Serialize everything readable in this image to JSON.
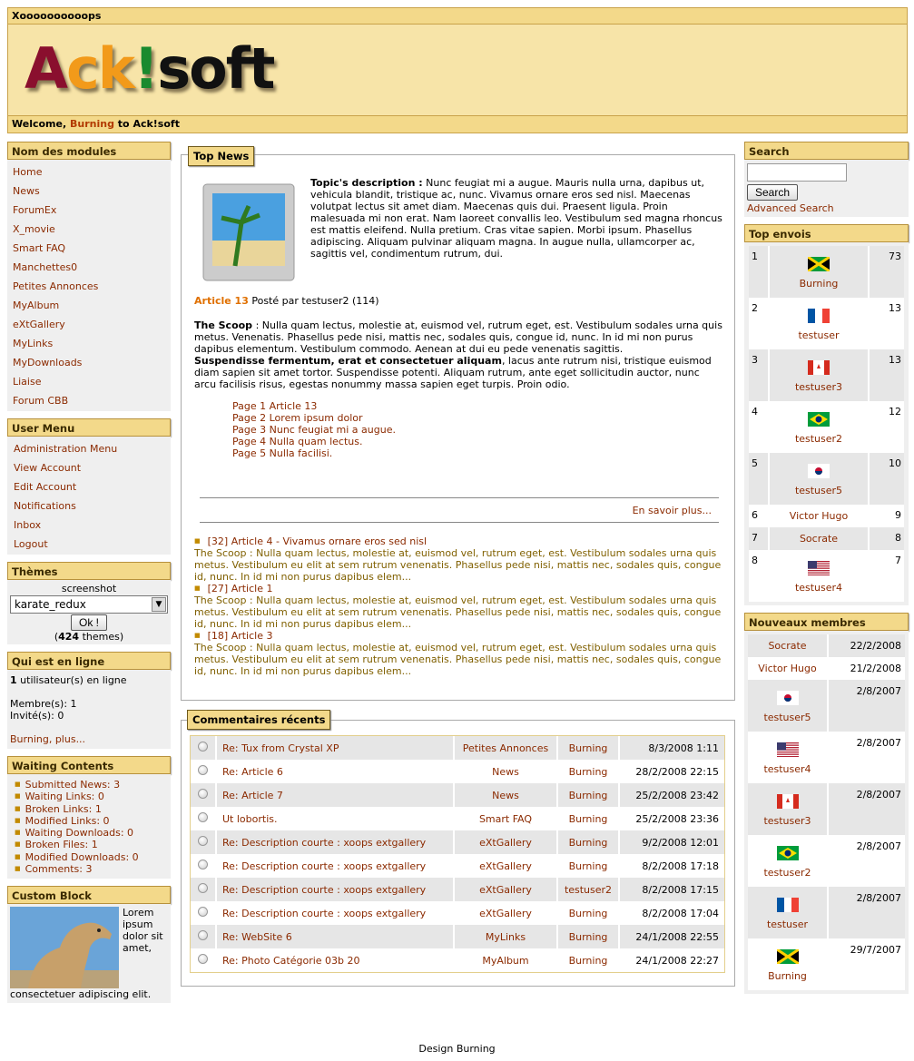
{
  "header": {
    "site_name": "Xoooooooooops",
    "logo": {
      "a": "Ack",
      "b": "!",
      "c": "soft"
    },
    "welcome_prefix": "Welcome,",
    "welcome_user": "Burning",
    "welcome_suffix": "to Ack!soft"
  },
  "modules": {
    "title": "Nom des modules",
    "items": [
      "Home",
      "News",
      "ForumEx",
      "X_movie",
      "Smart FAQ",
      "Manchettes0",
      "Petites Annonces",
      "MyAlbum",
      "eXtGallery",
      "MyLinks",
      "MyDownloads",
      "Liaise",
      "Forum CBB"
    ]
  },
  "user_menu": {
    "title": "User Menu",
    "items": [
      "Administration Menu",
      "View Account",
      "Edit Account",
      "Notifications",
      "Inbox",
      "Logout"
    ]
  },
  "themes": {
    "title": "Thèmes",
    "screenshot_label": "screenshot",
    "selected": "karate_redux",
    "ok": "Ok !",
    "count": "424",
    "count_suffix": "themes)"
  },
  "online": {
    "title": "Qui est en ligne",
    "users_num": "1",
    "users_text": "utilisateur(s) en ligne",
    "members": "Membre(s): 1",
    "guests": "Invité(s): 0",
    "link": "Burning, plus..."
  },
  "waiting": {
    "title": "Waiting Contents",
    "items": [
      "Submitted News: 3",
      "Waiting Links: 0",
      "Broken Links: 1",
      "Modified Links: 0",
      "Waiting Downloads: 0",
      "Broken Files: 1",
      "Modified Downloads: 0",
      "Comments: 3"
    ]
  },
  "custom": {
    "title": "Custom Block",
    "text": "Lorem ipsum dolor sit amet, consectetuer adipiscing elit."
  },
  "topnews": {
    "title": "Top News",
    "topic_label": "Topic's description :",
    "topic_text": "Nunc feugiat mi a augue. Mauris nulla urna, dapibus ut, vehicula blandit, tristique ac, nunc. Vivamus ornare eros sed nisl. Maecenas volutpat lectus sit amet diam. Maecenas quis dui. Praesent ligula. Proin malesuada mi non erat. Nam laoreet convallis leo. Vestibulum sed magna rhoncus est mattis eleifend. Nulla pretium. Cras vitae sapien. Morbi ipsum. Phasellus adipiscing. Aliquam pulvinar aliquam magna. In augue nulla, ullamcorper ac, sagittis vel, condimentum rutrum, dui.",
    "article_title": "Article 13",
    "article_meta": "Posté par testuser2 (114)",
    "scoop_label": "The Scoop",
    "scoop_text1": ": Nulla quam lectus, molestie at, euismod vel, rutrum eget, est. Vestibulum sodales urna quis metus. Venenatis. Phasellus pede nisi, mattis nec, sodales quis, congue id, nunc. In id mi non purus dapibus elementum. Vestibulum commodo. Aenean at dui eu pede venenatis sagittis.",
    "scoop_bold": "Suspendisse fermentum, erat et consectetuer aliquam",
    "scoop_text2": ", lacus ante rutrum nisi, tristique euismod diam sapien sit amet tortor. Suspendisse potenti. Aliquam rutrum, ante eget sollicitudin auctor, nunc arcu facilisis risus, egestas nonummy massa sapien eget turpis. Proin odio.",
    "pages": [
      "Page 1 Article 13",
      "Page 2 Lorem ipsum dolor",
      "Page 3 Nunc feugiat mi a augue.",
      "Page 4 Nulla quam lectus.",
      "Page 5 Nulla facilisi."
    ],
    "read_more": "En savoir plus...",
    "others": [
      {
        "title": "[32] Article 4 - Vivamus ornare eros sed nisl",
        "text": "The Scoop : Nulla quam lectus, molestie at, euismod vel, rutrum eget, est. Vestibulum sodales urna quis metus. Vestibulum eu elit at sem rutrum venenatis. Phasellus pede nisi, mattis nec, sodales quis, congue id, nunc. In id mi non purus dapibus elem..."
      },
      {
        "title": "[27] Article 1",
        "text": "The Scoop : Nulla quam lectus, molestie at, euismod vel, rutrum eget, est. Vestibulum sodales urna quis metus. Vestibulum eu elit at sem rutrum venenatis. Phasellus pede nisi, mattis nec, sodales quis, congue id, nunc. In id mi non purus dapibus elem..."
      },
      {
        "title": "[18] Article 3",
        "text": "The Scoop : Nulla quam lectus, molestie at, euismod vel, rutrum eget, est. Vestibulum sodales urna quis metus. Vestibulum eu elit at sem rutrum venenatis. Phasellus pede nisi, mattis nec, sodales quis, congue id, nunc. In id mi non purus dapibus elem..."
      }
    ]
  },
  "comments": {
    "title": "Commentaires récents",
    "rows": [
      [
        "Re: Tux from Crystal XP",
        "Petites Annonces",
        "Burning",
        "8/3/2008 1:11"
      ],
      [
        "Re: Article 6",
        "News",
        "Burning",
        "28/2/2008 22:15"
      ],
      [
        "Re: Article 7",
        "News",
        "Burning",
        "25/2/2008 23:42"
      ],
      [
        "Ut lobortis.",
        "Smart FAQ",
        "Burning",
        "25/2/2008 23:36"
      ],
      [
        "Re: Description courte : xoops extgallery",
        "eXtGallery",
        "Burning",
        "9/2/2008 12:01"
      ],
      [
        "Re: Description courte : xoops extgallery",
        "eXtGallery",
        "Burning",
        "8/2/2008 17:18"
      ],
      [
        "Re: Description courte : xoops extgallery",
        "eXtGallery",
        "testuser2",
        "8/2/2008 17:15"
      ],
      [
        "Re: Description courte : xoops extgallery",
        "eXtGallery",
        "Burning",
        "8/2/2008 17:04"
      ],
      [
        "Re: WebSite 6",
        "MyLinks",
        "Burning",
        "24/1/2008 22:55"
      ],
      [
        "Re: Photo Catégorie 03b 20",
        "MyAlbum",
        "Burning",
        "24/1/2008 22:27"
      ]
    ]
  },
  "search": {
    "title": "Search",
    "button": "Search",
    "advanced": "Advanced Search"
  },
  "top_posters": {
    "title": "Top envois",
    "rows": [
      {
        "rank": "1",
        "name": "Burning",
        "count": "73",
        "flag": "jamaica"
      },
      {
        "rank": "2",
        "name": "testuser",
        "count": "13",
        "flag": "france"
      },
      {
        "rank": "3",
        "name": "testuser3",
        "count": "13",
        "flag": "canada"
      },
      {
        "rank": "4",
        "name": "testuser2",
        "count": "12",
        "flag": "brazil"
      },
      {
        "rank": "5",
        "name": "testuser5",
        "count": "10",
        "flag": "korea"
      },
      {
        "rank": "6",
        "name": "Victor Hugo",
        "count": "9",
        "flag": ""
      },
      {
        "rank": "7",
        "name": "Socrate",
        "count": "8",
        "flag": ""
      },
      {
        "rank": "8",
        "name": "testuser4",
        "count": "7",
        "flag": "usa"
      }
    ]
  },
  "new_members": {
    "title": "Nouveaux membres",
    "rows": [
      {
        "name": "Socrate",
        "date": "22/2/2008",
        "flag": ""
      },
      {
        "name": "Victor Hugo",
        "date": "21/2/2008",
        "flag": ""
      },
      {
        "name": "testuser5",
        "date": "2/8/2007",
        "flag": "korea"
      },
      {
        "name": "testuser4",
        "date": "2/8/2007",
        "flag": "usa"
      },
      {
        "name": "testuser3",
        "date": "2/8/2007",
        "flag": "canada"
      },
      {
        "name": "testuser2",
        "date": "2/8/2007",
        "flag": "brazil"
      },
      {
        "name": "testuser",
        "date": "2/8/2007",
        "flag": "france"
      },
      {
        "name": "Burning",
        "date": "29/7/2007",
        "flag": "jamaica"
      }
    ]
  },
  "footer": "Design Burning"
}
